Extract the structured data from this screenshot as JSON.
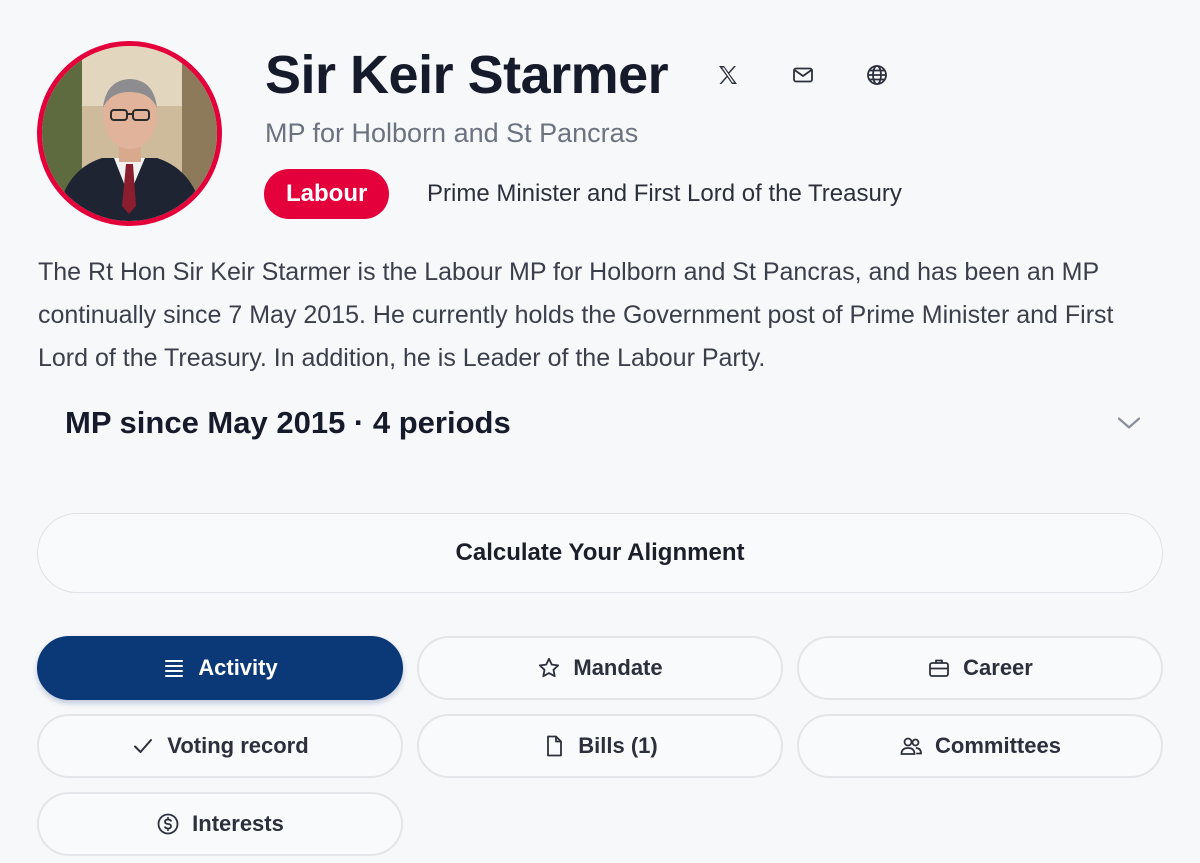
{
  "profile": {
    "name": "Sir Keir Starmer",
    "constituency": "MP for Holborn and St Pancras",
    "party": "Labour",
    "party_color": "#e4003b",
    "role": "Prime Minister and First Lord of the Treasury",
    "bio": "The Rt Hon Sir Keir Starmer is the Labour MP for Holborn and St Pancras, and has been an MP continually since 7 May 2015. He currently holds the Government post of Prime Minister and First Lord of the Treasury. In addition, he is Leader of the Labour Party.",
    "tenure": "MP since May 2015 · 4 periods"
  },
  "social": {
    "icons": [
      "x-icon",
      "mail-icon",
      "globe-icon"
    ]
  },
  "actions": {
    "alignment_label": "Calculate Your Alignment"
  },
  "tabs": [
    {
      "label": "Activity",
      "icon": "list-icon",
      "active": true
    },
    {
      "label": "Mandate",
      "icon": "star-icon",
      "active": false
    },
    {
      "label": "Career",
      "icon": "briefcase-icon",
      "active": false
    },
    {
      "label": "Voting record",
      "icon": "check-icon",
      "active": false
    },
    {
      "label": "Bills (1)",
      "icon": "document-icon",
      "active": false
    },
    {
      "label": "Committees",
      "icon": "users-icon",
      "active": false
    },
    {
      "label": "Interests",
      "icon": "dollar-icon",
      "active": false
    }
  ],
  "colors": {
    "accent": "#0b3877",
    "background": "#f7f8fa"
  }
}
